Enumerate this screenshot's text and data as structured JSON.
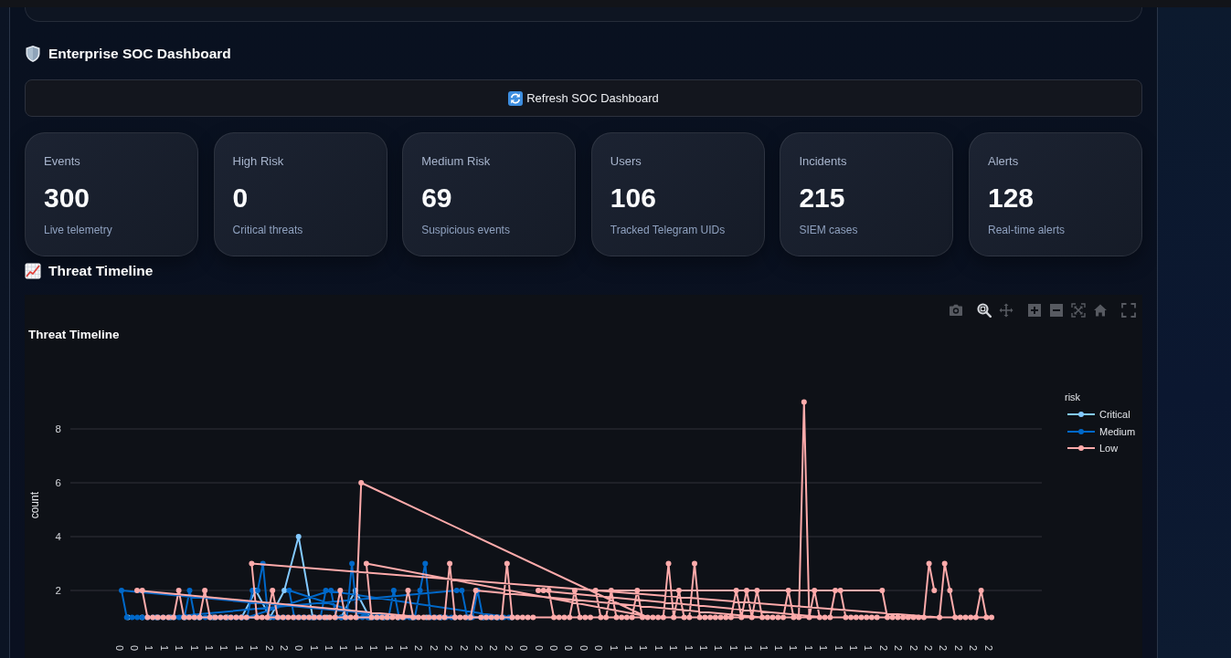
{
  "dashboard": {
    "title": "Enterprise SOC Dashboard"
  },
  "refresh_button": {
    "label": "Refresh SOC Dashboard"
  },
  "metrics": [
    {
      "label": "Events",
      "value": "300",
      "caption": "Live telemetry"
    },
    {
      "label": "High Risk",
      "value": "0",
      "caption": "Critical threats"
    },
    {
      "label": "Medium Risk",
      "value": "69",
      "caption": "Suspicious events"
    },
    {
      "label": "Users",
      "value": "106",
      "caption": "Tracked Telegram UIDs"
    },
    {
      "label": "Incidents",
      "value": "215",
      "caption": "SIEM cases"
    },
    {
      "label": "Alerts",
      "value": "128",
      "caption": "Real-time alerts"
    }
  ],
  "timeline": {
    "heading": "Threat Timeline",
    "modebar": [
      {
        "kind": "camera",
        "selected": false
      },
      {
        "kind": "zoom",
        "selected": true
      },
      {
        "kind": "pan",
        "selected": false
      },
      {
        "kind": "zoom_in",
        "selected": false
      },
      {
        "kind": "zoom_out",
        "selected": false
      },
      {
        "kind": "autoscale",
        "selected": false
      },
      {
        "kind": "home",
        "selected": false
      },
      {
        "kind": "fullscreen",
        "selected": false
      }
    ],
    "chart": {
      "title": "Threat Timeline",
      "ylabel": "count",
      "yticks": [
        "8",
        "6",
        "4",
        "2"
      ],
      "legend_title": "risk",
      "legend": [
        {
          "name": "Critical",
          "color": "#83c9ff"
        },
        {
          "name": "Medium",
          "color": "#0068c9"
        },
        {
          "name": "Low",
          "color": "#ffabab"
        }
      ],
      "x_labels": [
        "0",
        "0",
        "1",
        "1",
        "1",
        "1",
        "1",
        "1",
        "1",
        "1",
        "2",
        "2",
        "0",
        "1",
        "1",
        "1",
        "1",
        "1",
        "1",
        "1",
        "2",
        "2",
        "2",
        "2",
        "2",
        "2",
        "2",
        "0",
        "0",
        "0",
        "0",
        "0",
        "0",
        "1",
        "1",
        "1",
        "1",
        "1",
        "1",
        "1",
        "1",
        "1",
        "1",
        "1",
        "1",
        "1",
        "1",
        "1",
        "1",
        "1",
        "1",
        "2",
        "2",
        "2",
        "2",
        "2",
        "2",
        "2",
        "2"
      ]
    }
  }
}
